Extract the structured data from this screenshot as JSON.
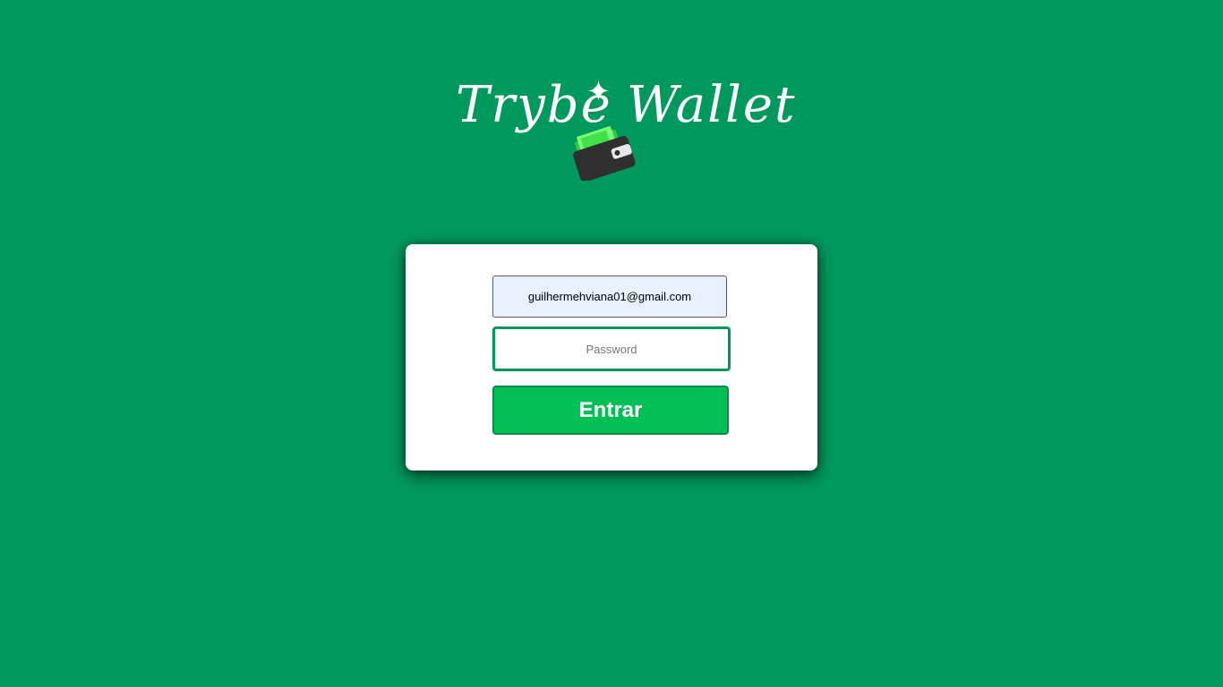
{
  "logo": {
    "word_left": "Trybe",
    "word_right": "Wallet",
    "sparkle_glyph": "✦",
    "wallet_icon": "wallet-with-cash-icon",
    "sparkle_icon": "sparkle-icon"
  },
  "login": {
    "email_value": "guilhermehviana01@gmail.com",
    "password_placeholder": "Password",
    "password_value": "",
    "submit_label": "Entrar"
  },
  "colors": {
    "background": "#00995d",
    "button": "#00bf55",
    "autofill": "#e8f0fe"
  }
}
